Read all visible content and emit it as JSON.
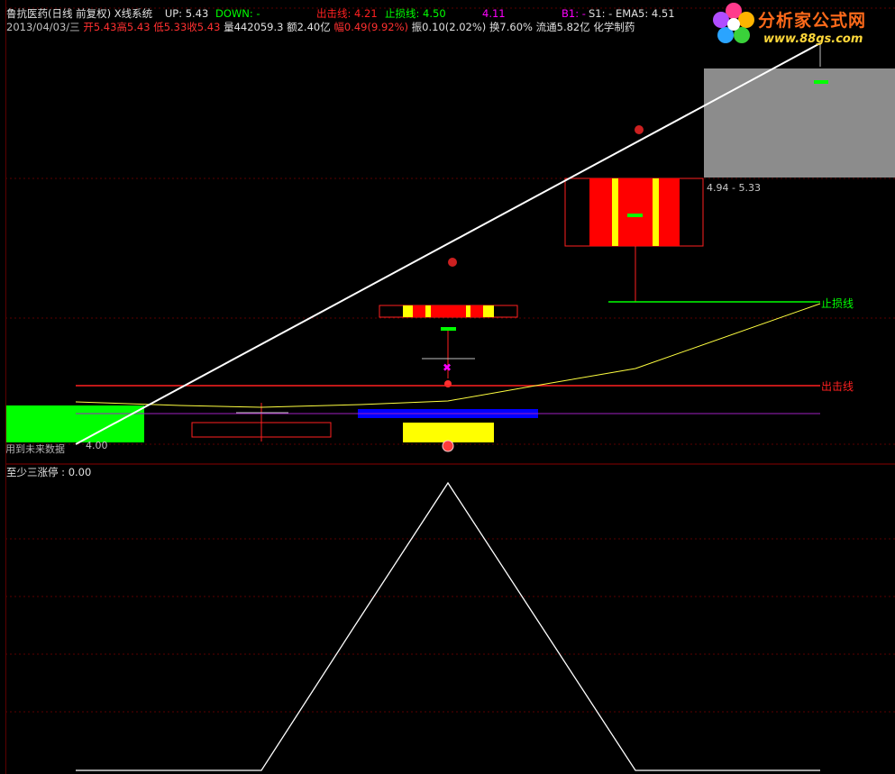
{
  "header": {
    "title": "鲁抗医药(日线 前复权) X线系统",
    "up_label": "UP: 5.43",
    "down_label": "DOWN: -",
    "chuji_label": "出击线: 4.21",
    "zhisun_label": "止损线: 4.50",
    "extra_value": "4.11",
    "b1_label": "B1: -",
    "s1_label": "S1: -",
    "ema5_label": "EMA5: 4.51"
  },
  "info_row": {
    "date": "2013/04/03/三",
    "open": "开5.43",
    "high": "高5.43",
    "low": "低5.33",
    "close": "收5.43",
    "volume": "量442059.3",
    "amount": "额2.40亿",
    "change": "幅0.49(9.92%)",
    "amplitude": "振0.10(2.02%)",
    "turnover": "换7.60%",
    "float_cap": "流通5.82亿",
    "sector": "化学制药"
  },
  "logo": {
    "name": "分析家公式网",
    "url": "www.88gs.com"
  },
  "colors": {
    "background": "#000000",
    "red": "#ff0000",
    "yellow": "#ffff00",
    "green": "#00ff00",
    "blue": "#0000ff",
    "white": "#ffffff",
    "magenta": "#ff00ff",
    "gray": "#808080",
    "grid": "#5a0000"
  },
  "chart_data": [
    {
      "type": "line",
      "name": "main",
      "annotations": {
        "range_label": "4.94 - 5.33",
        "zhisun_line_label": "止损线",
        "chuji_line_label": "出击线",
        "future_data_label": "用到未来数据",
        "future_data_value": "4.00"
      },
      "levels": {
        "chuji": 4.21,
        "zhisun": 4.5,
        "ema5": 4.51
      }
    },
    {
      "type": "line",
      "name": "sub",
      "title": "至少三涨停",
      "value_label": "0.00",
      "x": [
        0,
        1,
        2,
        3,
        4,
        5,
        6,
        7,
        8
      ],
      "values": [
        0,
        0,
        0,
        1,
        2,
        1,
        0,
        0,
        0
      ]
    }
  ]
}
